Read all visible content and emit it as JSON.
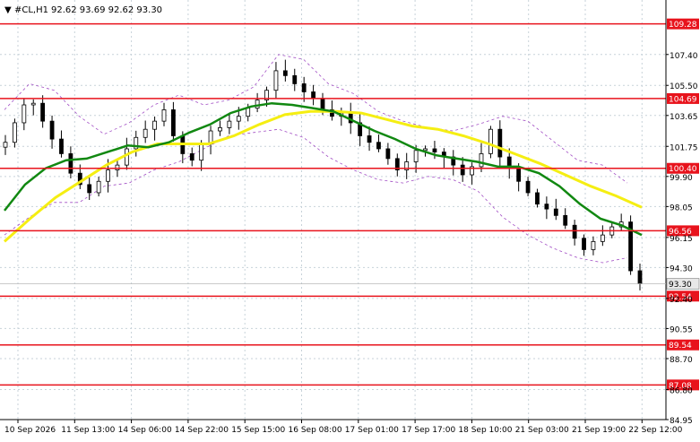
{
  "header": {
    "symbol": "#CL,H1",
    "quote": "92.62 93.69 92.62 93.30"
  },
  "colors": {
    "background": "#ffffff",
    "grid": "#c7d2d9",
    "candle": "#000000",
    "level_line": "#e8131c",
    "level_label_bg": "#e8131c",
    "ma_fast": "#118811",
    "ma_slow": "#f5ee12",
    "bands": "#a14cc4",
    "price_label_bg": "#e8e8e8"
  },
  "chart_data": {
    "type": "candlestick",
    "instrument": "#CL",
    "timeframe": "H1",
    "ohlc_last": {
      "open": 92.62,
      "high": 93.69,
      "low": 92.62,
      "close": 93.3
    },
    "current_price": 93.3,
    "ylim": [
      84.95,
      110.75
    ],
    "y_ticks": [
      107.4,
      105.5,
      103.65,
      101.75,
      99.9,
      98.05,
      96.15,
      94.3,
      92.4,
      90.55,
      88.7,
      86.8,
      84.95
    ],
    "x_ticks": [
      "10 Sep 2026",
      "11 Sep 13:00",
      "14 Sep 06:00",
      "14 Sep 22:00",
      "15 Sep 15:00",
      "16 Sep 08:00",
      "17 Sep 01:00",
      "17 Sep 17:00",
      "18 Sep 10:00",
      "21 Sep 03:00",
      "21 Sep 19:00",
      "22 Sep 12:00"
    ],
    "levels": [
      109.28,
      104.69,
      100.4,
      96.56,
      92.54,
      89.54,
      87.08
    ],
    "level_labels": [
      "109.28",
      "104.69",
      "100.40",
      "96.56",
      "92.54",
      "89.54",
      "87.08"
    ],
    "close_series": [
      102.0,
      103.2,
      104.3,
      104.4,
      103.3,
      102.2,
      101.3,
      100.1,
      99.4,
      98.9,
      99.6,
      100.3,
      100.6,
      101.6,
      102.3,
      102.8,
      103.3,
      104.0,
      102.4,
      101.3,
      100.9,
      101.9,
      102.7,
      102.9,
      103.3,
      103.6,
      104.1,
      104.6,
      105.2,
      106.4,
      106.1,
      105.6,
      105.1,
      104.7,
      104.0,
      103.6,
      103.8,
      103.2,
      102.4,
      102.0,
      101.6,
      101.0,
      100.3,
      100.8,
      101.5,
      101.6,
      101.4,
      101.1,
      100.6,
      100.0,
      100.5,
      101.3,
      102.8,
      101.1,
      100.4,
      99.6,
      98.9,
      98.2,
      97.9,
      97.5,
      96.9,
      96.1,
      95.4,
      95.9,
      96.3,
      96.8,
      97.1,
      94.1,
      93.3
    ],
    "fast_ma_series": [
      97.8,
      99.4,
      100.4,
      100.9,
      101.0,
      101.4,
      101.8,
      101.7,
      102.0,
      102.6,
      103.1,
      103.8,
      104.2,
      104.4,
      104.3,
      104.1,
      103.9,
      103.3,
      102.7,
      102.2,
      101.6,
      101.2,
      101.0,
      100.8,
      100.5,
      100.5,
      100.1,
      99.3,
      98.2,
      97.3,
      96.9,
      96.3
    ],
    "slow_ma_series": [
      95.9,
      97.3,
      98.6,
      99.6,
      100.6,
      101.4,
      101.9,
      101.9,
      101.9,
      102.4,
      103.1,
      103.7,
      103.9,
      103.9,
      103.8,
      103.4,
      103.0,
      102.8,
      102.4,
      101.9,
      101.3,
      100.7,
      100.0,
      99.3,
      98.7,
      98.0
    ],
    "band_upper_series": [
      104.0,
      105.6,
      105.2,
      103.6,
      102.5,
      103.2,
      104.3,
      104.9,
      104.3,
      104.6,
      105.4,
      107.4,
      107.1,
      105.6,
      105.0,
      103.9,
      103.3,
      102.9,
      102.7,
      103.1,
      103.6,
      103.3,
      102.1,
      100.9,
      100.6,
      99.5
    ],
    "band_lower_series": [
      96.3,
      97.4,
      98.3,
      98.3,
      99.3,
      99.5,
      100.3,
      100.8,
      101.6,
      102.4,
      102.6,
      102.8,
      102.3,
      101.1,
      100.3,
      99.7,
      99.5,
      99.9,
      99.7,
      99.0,
      97.4,
      96.3,
      95.5,
      94.9,
      94.6,
      94.9
    ]
  }
}
